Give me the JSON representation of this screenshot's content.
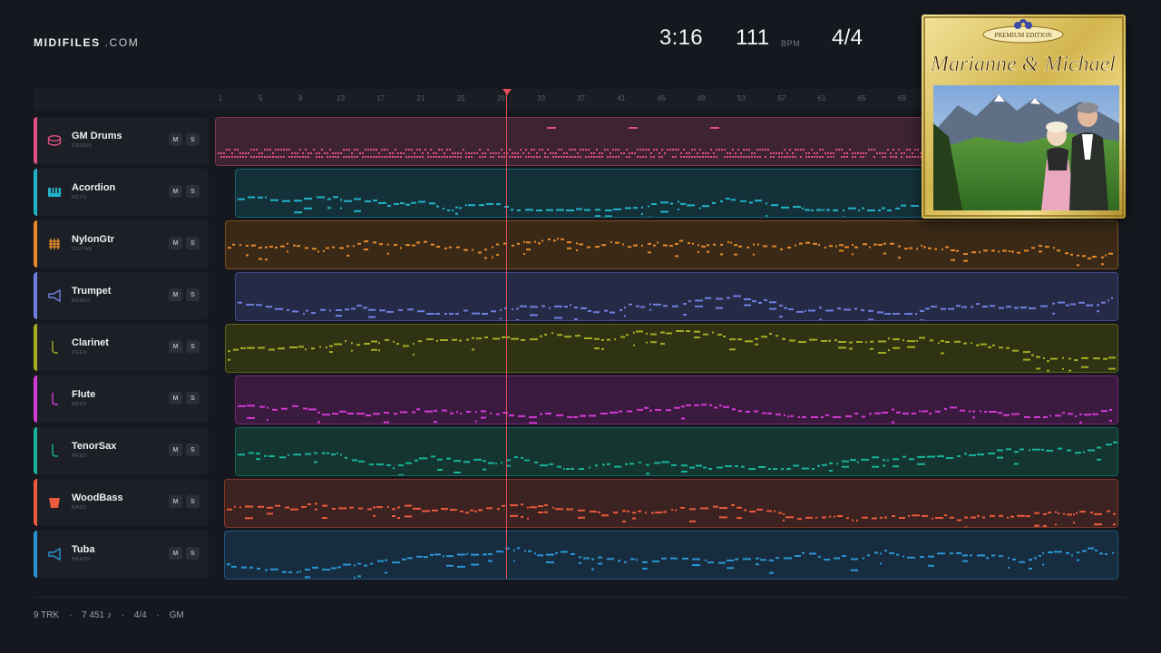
{
  "brand": {
    "bold": "MIDIFILES",
    "light": " .COM"
  },
  "header": {
    "time": "3:16",
    "bpm": "111",
    "bpm_unit": "BPM",
    "meter": "4/4"
  },
  "ruler": {
    "marks": [
      "1",
      "5",
      "9",
      "13",
      "17",
      "21",
      "25",
      "29",
      "33",
      "37",
      "41",
      "45",
      "49",
      "53",
      "57",
      "61",
      "65",
      "69"
    ]
  },
  "playhead_bar": 29,
  "tracks": [
    {
      "name": "GM Drums",
      "sub": "DRUMS",
      "icon": "drum-icon",
      "color": "#e04f86",
      "lane_bg": "#3d2430"
    },
    {
      "name": "Acordion",
      "sub": "KEYS",
      "icon": "keys-icon",
      "color": "#22b3c9",
      "lane_bg": "#143139"
    },
    {
      "name": "NylonGtr",
      "sub": "GUITAR",
      "icon": "guitar-icon",
      "color": "#e5892a",
      "lane_bg": "#3a2916"
    },
    {
      "name": "Trumpet",
      "sub": "BRASS",
      "icon": "trumpet-icon",
      "color": "#6f7fe0",
      "lane_bg": "#252a46"
    },
    {
      "name": "Clarinet",
      "sub": "REED",
      "icon": "clarinet-icon",
      "color": "#a3ad22",
      "lane_bg": "#2f3314"
    },
    {
      "name": "Flute",
      "sub": "REED",
      "icon": "flute-icon",
      "color": "#d13ad4",
      "lane_bg": "#3b1a3f"
    },
    {
      "name": "TenorSax",
      "sub": "REED",
      "icon": "sax-icon",
      "color": "#19b39b",
      "lane_bg": "#143530"
    },
    {
      "name": "WoodBass",
      "sub": "BASS",
      "icon": "bass-icon",
      "color": "#ea5a3c",
      "lane_bg": "#3c2220"
    },
    {
      "name": "Tuba",
      "sub": "BRASS",
      "icon": "tuba-icon",
      "color": "#2b95d4",
      "lane_bg": "#172d3f"
    }
  ],
  "buttons": {
    "mute": "M",
    "solo": "S"
  },
  "cover": {
    "edition": "PREMIUM EDITION",
    "title": "Marianne & Michael"
  },
  "footer": {
    "tracks": "9 TRK",
    "sep1": "·",
    "notes": "7 451 ♪",
    "sep2": "·",
    "meter": "4/4",
    "sep3": "·",
    "mode": "GM"
  }
}
